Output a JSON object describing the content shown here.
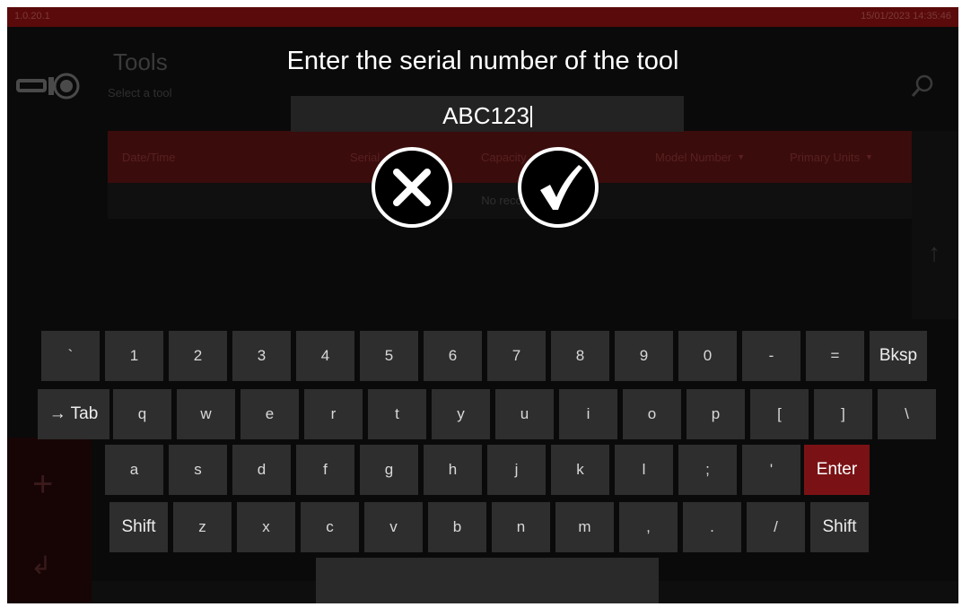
{
  "app": {
    "version": "1.0.20.1",
    "clock": "15/01/2023 14:35:46",
    "title": "Tools",
    "subtitle": "Select a tool",
    "table_columns": [
      "Date/Time",
      "Serial",
      "Capacity",
      "Model Number",
      "Primary Units"
    ],
    "empty_text": "No records"
  },
  "dialog": {
    "prompt": "Enter the serial number of the tool",
    "value": "ABC123"
  },
  "keyboard": {
    "rows": [
      [
        "`",
        "1",
        "2",
        "3",
        "4",
        "5",
        "6",
        "7",
        "8",
        "9",
        "0",
        "-",
        "=",
        "Bksp"
      ],
      [
        "→ Tab",
        "q",
        "w",
        "e",
        "r",
        "t",
        "y",
        "u",
        "i",
        "o",
        "p",
        "[",
        "]",
        "\\"
      ],
      [
        "a",
        "s",
        "d",
        "f",
        "g",
        "h",
        "j",
        "k",
        "l",
        ";",
        "'",
        "Enter"
      ],
      [
        "Shift",
        "z",
        "x",
        "c",
        "v",
        "b",
        "n",
        "m",
        ",",
        ".",
        "/",
        "Shift"
      ]
    ]
  },
  "colors": {
    "accent": "#7a1215",
    "background": "#0a0a0a",
    "key": "#2e2e2e"
  }
}
